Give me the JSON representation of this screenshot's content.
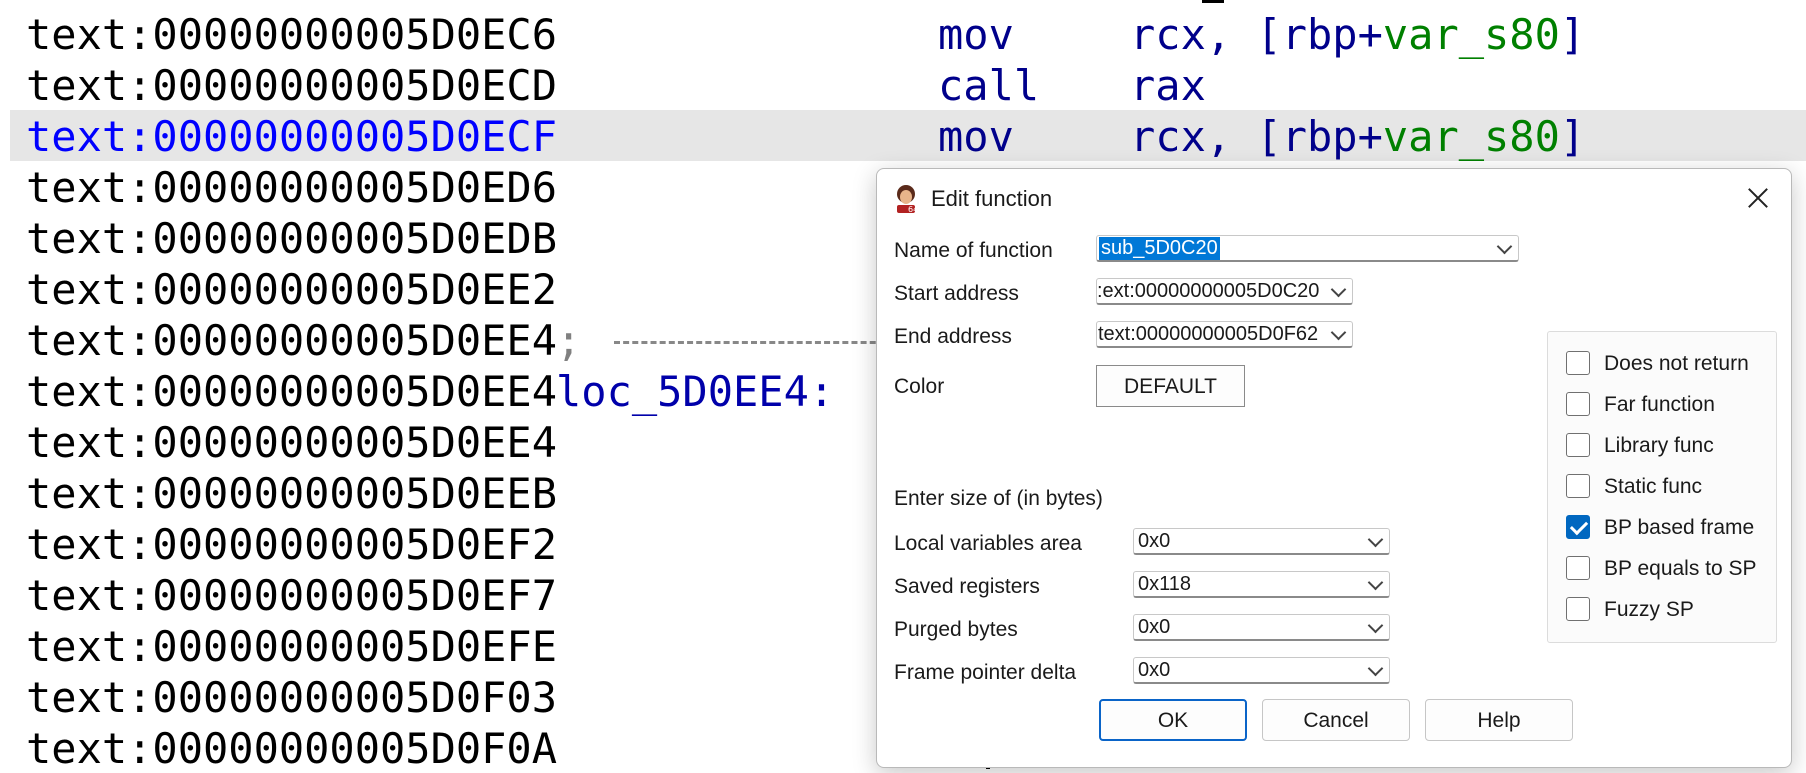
{
  "listing": {
    "lines": [
      {
        "addr": "text:00000000005D0EC6",
        "mnem": "mov",
        "ops_a": "rcx, [rbp+",
        "ops_var": "var_s80",
        "ops_b": "]"
      },
      {
        "addr": "text:00000000005D0ECD",
        "mnem": "call",
        "ops_a": "rax",
        "ops_var": "",
        "ops_b": ""
      },
      {
        "addr": "text:00000000005D0ECF",
        "mnem": "mov",
        "ops_a": "rcx, [rbp+",
        "ops_var": "var_s80",
        "ops_b": "]"
      },
      {
        "addr": "text:00000000005D0ED6"
      },
      {
        "addr": "text:00000000005D0EDB"
      },
      {
        "addr": "text:00000000005D0EE2"
      },
      {
        "addr": "text:00000000005D0EE4",
        "comment": ";"
      },
      {
        "addr": "text:00000000005D0EE4",
        "label": "loc_5D0EE4:"
      },
      {
        "addr": "text:00000000005D0EE4"
      },
      {
        "addr": "text:00000000005D0EEB"
      },
      {
        "addr": "text:00000000005D0EF2"
      },
      {
        "addr": "text:00000000005D0EF7"
      },
      {
        "addr": "text:00000000005D0EFE"
      },
      {
        "addr": "text:00000000005D0F03"
      },
      {
        "addr": "text:00000000005D0F0A"
      }
    ]
  },
  "dialog": {
    "title": "Edit function",
    "name_label": "Name of function",
    "name_value": "sub_5D0C20",
    "start_label": "Start address",
    "start_value": ":ext:00000000005D0C20",
    "end_label": "End address",
    "end_value": "text:00000000005D0F62",
    "color_label": "Color",
    "color_button": "DEFAULT",
    "size_heading": "Enter size of (in bytes)",
    "local_label": "Local variables area",
    "local_value": "0x0",
    "saved_label": "Saved registers",
    "saved_value": "0x118",
    "purged_label": "Purged bytes",
    "purged_value": "0x0",
    "fpd_label": "Frame pointer delta",
    "fpd_value": "0x0",
    "checkboxes": [
      {
        "label": "Does not return",
        "checked": false
      },
      {
        "label": "Far function",
        "checked": false
      },
      {
        "label": "Library func",
        "checked": false
      },
      {
        "label": "Static func",
        "checked": false
      },
      {
        "label": "BP based frame",
        "checked": true
      },
      {
        "label": "BP equals to SP",
        "checked": false
      },
      {
        "label": "Fuzzy SP",
        "checked": false
      }
    ],
    "ok_label": "OK",
    "cancel_label": "Cancel",
    "help_label": "Help"
  },
  "colors": {
    "selected_address": "#0000ff",
    "mnemonic": "#00008b",
    "variable": "#008000",
    "selection_highlight": "#0078d7",
    "checkbox_accent": "#0067c0"
  }
}
